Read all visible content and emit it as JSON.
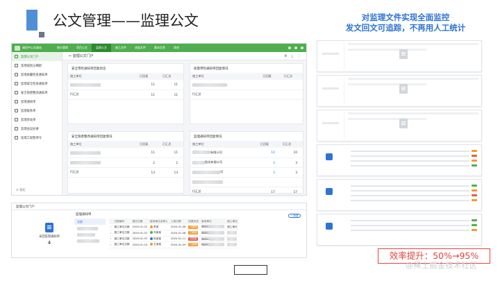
{
  "slide": {
    "title": "公文管理——监理公文",
    "tagline_line1": "对监理文件实现全面监控",
    "tagline_line2": "发文回文可追踪，不再用人工统计",
    "efficiency": "效率提升：50%→95%",
    "watermark": "@稀土掘金技术社区"
  },
  "app": {
    "brand": "福田中心实施站",
    "nav": [
      "统计管理",
      "项目公文",
      "监理公文",
      "施工文件",
      "进度文件",
      "基本信息",
      "其他"
    ],
    "active_nav_index": 2,
    "tab_title": "监理公文门户",
    "sidebar": [
      "监理公文门户",
      "监理规划与细则",
      "监理质量检查通知单",
      "监理安全检查通知单",
      "安全隐患整改通知单",
      "监理通知单",
      "监理联系单",
      "监理旁站单",
      "监理会议纪要",
      "监理工程暂停令"
    ],
    "collapse_label": "收起",
    "panels": [
      {
        "title": "安全用检通知单回复状态",
        "headers": [
          "施工单位",
          "",
          "已回复",
          "",
          "",
          "已汇总"
        ],
        "rows": [
          [
            "",
            "",
            "11",
            "11"
          ],
          [
            "行汇总",
            "",
            "11",
            "11"
          ]
        ]
      },
      {
        "title": "质量用检通知单回复情况",
        "headers": [
          "施工单位",
          "",
          "已回复",
          "",
          "",
          "已汇总"
        ],
        "rows": [
          [
            "",
            "",
            "",
            ""
          ],
          [
            "行汇总",
            "",
            "",
            ""
          ]
        ]
      },
      {
        "title": "安全隐患整改通知单回复情况",
        "headers": [
          "施工单位",
          "",
          "已回复",
          "",
          "",
          "已汇总"
        ],
        "rows": [
          [
            "",
            "",
            "11",
            "11"
          ],
          [
            "",
            "",
            "2",
            "2"
          ],
          [
            "行汇总",
            "",
            "13",
            "13"
          ]
        ]
      },
      {
        "title": "监理通知单回复情况",
        "headers": [
          "施工单位",
          "",
          "已回复",
          "",
          "",
          "已汇总"
        ],
        "rows": [
          [
            "有限公司",
            "",
            "10",
            "10"
          ],
          [
            "股份有限公司",
            "",
            "3",
            "3"
          ],
          [
            "司",
            "",
            "3",
            "3"
          ],
          [
            "",
            "",
            "",
            ""
          ],
          [
            "行汇总",
            "",
            "17",
            "17"
          ]
        ]
      }
    ]
  },
  "app2": {
    "title": "监理公文门户",
    "card_label": "未回监理通知单",
    "card_count": "4",
    "sub_title": "监理通知单",
    "add_button": "+ 新建",
    "tree": [
      "全部",
      "",
      "",
      "",
      ""
    ],
    "columns": [
      "",
      "日报编号",
      "单元年",
      "提交日期",
      "接收单位名称人",
      "提交人",
      "上报日期",
      "回复状态",
      "接收单位",
      "施工单位"
    ],
    "rows": [
      {
        "code": "施工单位日报",
        "date": "2020-01-02",
        "person": "李某",
        "date2": "2020-01-08",
        "status": "已超期",
        "color": "orange",
        "recv": "福田区",
        "unit": "施工单位"
      },
      {
        "code": "施工单位日报",
        "date": "2020-01-02",
        "person": "刘某某",
        "date2": "2020-01-08",
        "status": "已超期",
        "color": "orange",
        "recv": "福田区",
        "unit": ""
      },
      {
        "code": "施工单位日报",
        "date": "2020-01-03",
        "person": "张某某",
        "date2": "2020-01-11",
        "status": "未回复",
        "color": "red",
        "recv": "福田区",
        "unit": ""
      },
      {
        "code": "施工单位日报",
        "date": "2020-01-04",
        "person": "王某某",
        "date2": "2020-01-09",
        "status": "已超期",
        "color": "orange",
        "recv": "福田区",
        "unit": ""
      }
    ]
  },
  "colors": {
    "accent_blue": "#2d73d4",
    "nav_green": "#4fae4e",
    "highlight_red": "#e0443c"
  },
  "icons": [
    "document-icon",
    "gear-icon",
    "download-icon",
    "more-icon"
  ]
}
